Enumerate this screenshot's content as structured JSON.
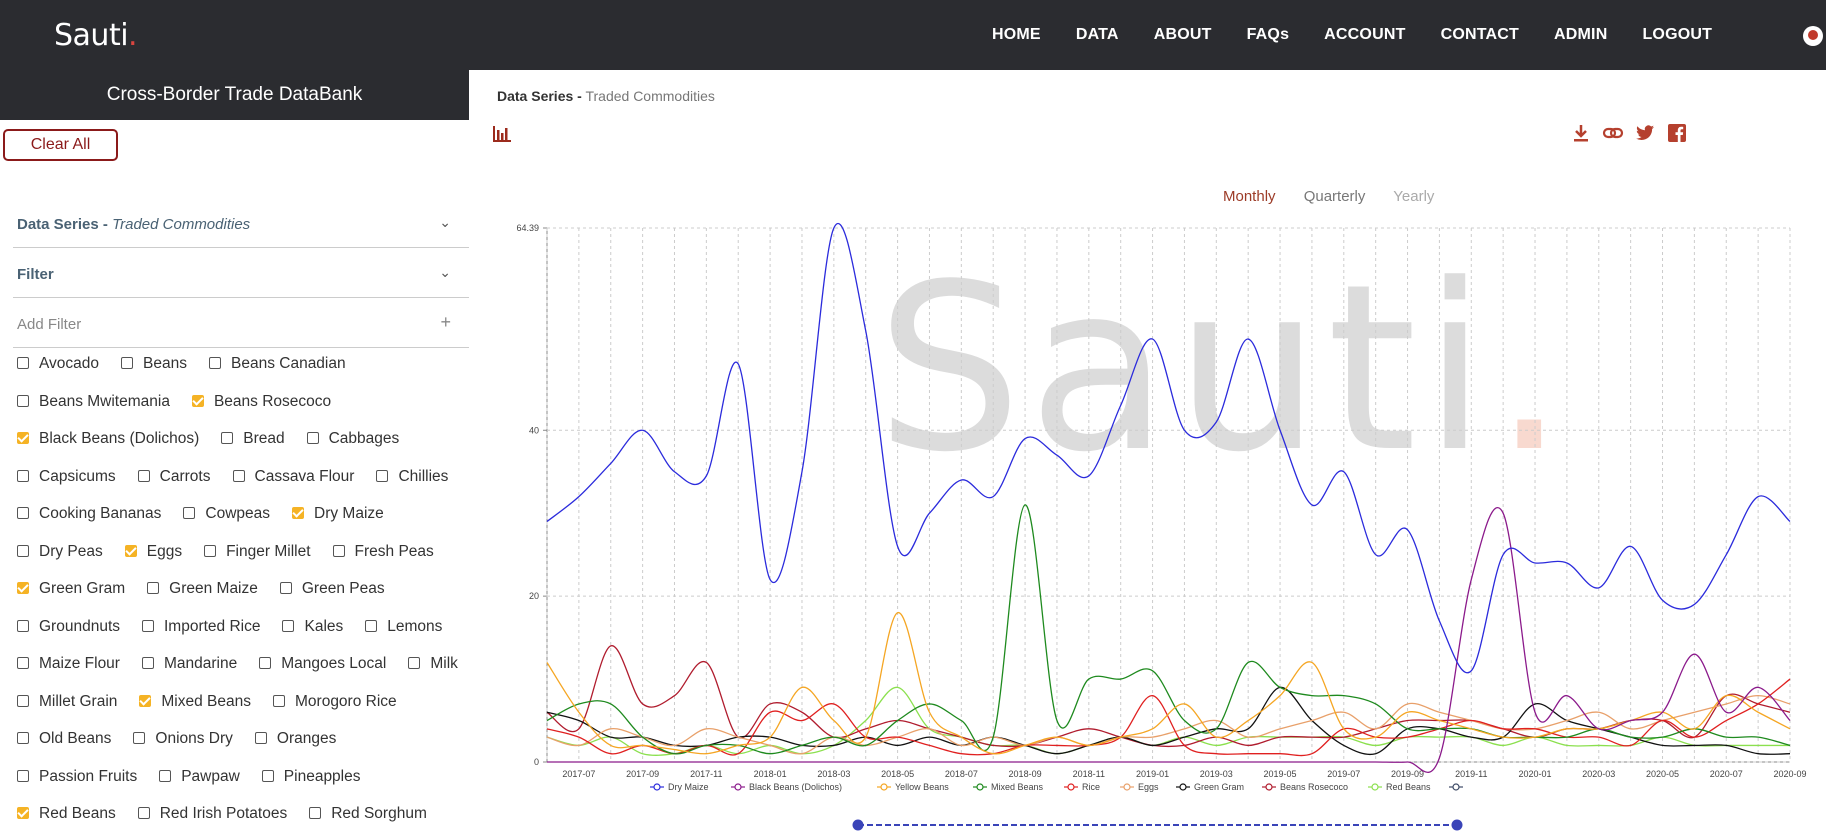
{
  "nav": {
    "logo": "Sauti",
    "logo_dot": ".",
    "links": [
      "HOME",
      "DATA",
      "ABOUT",
      "FAQs",
      "ACCOUNT",
      "CONTACT",
      "ADMIN",
      "LOGOUT"
    ]
  },
  "sidebar": {
    "title": "Cross-Border Trade DataBank",
    "clear_all": "Clear All",
    "data_series_label": "Data Series -",
    "data_series_value": "Traded Commodities",
    "filter_label": "Filter",
    "add_filter_label": "Add Filter",
    "rows": [
      [
        {
          "label": "Avocado",
          "checked": false
        },
        {
          "label": "Beans",
          "checked": false
        },
        {
          "label": "Beans Canadian",
          "checked": false
        }
      ],
      [
        {
          "label": "Beans Mwitemania",
          "checked": false
        },
        {
          "label": "Beans Rosecoco",
          "checked": true
        }
      ],
      [
        {
          "label": "Black Beans (Dolichos)",
          "checked": true
        },
        {
          "label": "Bread",
          "checked": false
        },
        {
          "label": "Cabbages",
          "checked": false
        }
      ],
      [
        {
          "label": "Capsicums",
          "checked": false
        },
        {
          "label": "Carrots",
          "checked": false
        },
        {
          "label": "Cassava Flour",
          "checked": false
        },
        {
          "label": "Chillies",
          "checked": false
        }
      ],
      [
        {
          "label": "Cooking Bananas",
          "checked": false
        },
        {
          "label": "Cowpeas",
          "checked": false
        },
        {
          "label": "Dry Maize",
          "checked": true
        }
      ],
      [
        {
          "label": "Dry Peas",
          "checked": false
        },
        {
          "label": "Eggs",
          "checked": true
        },
        {
          "label": "Finger Millet",
          "checked": false
        },
        {
          "label": "Fresh Peas",
          "checked": false
        }
      ],
      [
        {
          "label": "Green Gram",
          "checked": true
        },
        {
          "label": "Green Maize",
          "checked": false
        },
        {
          "label": "Green Peas",
          "checked": false
        }
      ],
      [
        {
          "label": "Groundnuts",
          "checked": false
        },
        {
          "label": "Imported Rice",
          "checked": false
        },
        {
          "label": "Kales",
          "checked": false
        },
        {
          "label": "Lemons",
          "checked": false
        }
      ],
      [
        {
          "label": "Maize Flour",
          "checked": false
        },
        {
          "label": "Mandarine",
          "checked": false
        },
        {
          "label": "Mangoes Local",
          "checked": false
        },
        {
          "label": "Milk",
          "checked": false
        }
      ],
      [
        {
          "label": "Millet Grain",
          "checked": false
        },
        {
          "label": "Mixed Beans",
          "checked": true
        },
        {
          "label": "Morogoro Rice",
          "checked": false
        }
      ],
      [
        {
          "label": "Old Beans",
          "checked": false
        },
        {
          "label": "Onions Dry",
          "checked": false
        },
        {
          "label": "Oranges",
          "checked": false
        }
      ],
      [
        {
          "label": "Passion Fruits",
          "checked": false
        },
        {
          "label": "Pawpaw",
          "checked": false
        },
        {
          "label": "Pineapples",
          "checked": false
        }
      ],
      [
        {
          "label": "Red Beans",
          "checked": true
        },
        {
          "label": "Red Irish Potatoes",
          "checked": false
        },
        {
          "label": "Red Sorghum",
          "checked": false
        }
      ]
    ]
  },
  "main": {
    "title_bold": "Data Series -",
    "title_sub": "Traded Commodities",
    "periods": [
      "Monthly",
      "Quarterly",
      "Yearly"
    ],
    "selected_period": "Monthly",
    "watermark": "Sauti",
    "watermark_dot": ".",
    "share_icons": [
      "download-icon",
      "link-icon",
      "twitter-icon",
      "facebook-icon"
    ]
  },
  "chart_data": {
    "type": "line",
    "x": [
      "2017-06",
      "2017-07",
      "2017-08",
      "2017-09",
      "2017-10",
      "2017-11",
      "2017-12",
      "2018-01",
      "2018-02",
      "2018-03",
      "2018-04",
      "2018-05",
      "2018-06",
      "2018-07",
      "2018-08",
      "2018-09",
      "2018-10",
      "2018-11",
      "2018-12",
      "2019-01",
      "2019-02",
      "2019-03",
      "2019-04",
      "2019-05",
      "2019-06",
      "2019-07",
      "2019-08",
      "2019-09",
      "2019-10",
      "2019-11",
      "2019-12",
      "2020-01",
      "2020-02",
      "2020-03",
      "2020-04",
      "2020-05",
      "2020-06",
      "2020-07",
      "2020-08",
      "2020-09"
    ],
    "x_ticks": [
      "2017-07",
      "2017-09",
      "2017-11",
      "2018-01",
      "2018-03",
      "2018-05",
      "2018-07",
      "2018-09",
      "2018-11",
      "2019-01",
      "2019-03",
      "2019-05",
      "2019-07",
      "2019-09",
      "2019-11",
      "2020-01",
      "2020-03",
      "2020-05",
      "2020-07",
      "2020-09"
    ],
    "y_ticks": [
      "0",
      "20",
      "40",
      "64.39"
    ],
    "ylim": [
      0,
      64.39
    ],
    "grid": true,
    "legend_position": "bottom",
    "series": [
      {
        "name": "Dry Maize",
        "color": "#2b2bdc",
        "values": [
          29,
          32,
          36,
          40,
          35,
          34.5,
          48,
          22,
          35,
          64.39,
          52,
          26,
          30,
          34,
          32,
          39,
          37,
          34.5,
          43,
          51,
          40,
          41,
          51,
          40,
          31,
          35,
          25,
          28,
          17,
          11,
          25,
          24,
          24,
          21,
          26,
          19.5,
          19,
          25,
          32,
          29
        ]
      },
      {
        "name": "Black Beans (Dolichos)",
        "color": "#8b1a8b",
        "values": [
          0,
          0,
          0,
          0,
          0,
          0,
          0,
          0,
          0,
          0,
          0,
          0,
          0,
          0,
          0,
          0,
          0,
          0,
          0,
          0,
          0,
          0,
          0,
          0,
          0,
          0,
          0,
          0,
          0.5,
          22,
          30,
          6,
          8,
          4,
          5,
          6,
          13,
          6,
          9,
          5
        ]
      },
      {
        "name": "Yellow Beans",
        "color": "#f5a623",
        "values": [
          12,
          6,
          2,
          2,
          1.5,
          1,
          2,
          3,
          9,
          5,
          3,
          18,
          6,
          3,
          1,
          2,
          3,
          2,
          3,
          4,
          7,
          3,
          5,
          8,
          12,
          4,
          3,
          6,
          5,
          4,
          3,
          3,
          4,
          4,
          5,
          6,
          4,
          8,
          6,
          4
        ]
      },
      {
        "name": "Mixed Beans",
        "color": "#1e8a1e",
        "values": [
          5,
          7,
          7,
          3,
          1,
          2,
          2,
          1,
          2,
          3,
          2,
          5,
          7,
          5,
          3,
          31,
          5,
          10,
          10,
          11,
          5,
          4,
          12,
          9,
          8,
          8,
          7,
          4,
          4,
          4,
          3,
          3,
          3,
          4,
          3,
          3,
          4,
          3,
          3,
          2
        ]
      },
      {
        "name": "Rice",
        "color": "#e02020",
        "values": [
          4,
          3,
          1,
          2,
          1,
          2,
          1,
          6,
          5,
          7,
          3,
          3,
          2,
          1,
          1,
          2,
          2,
          2,
          3,
          8,
          2,
          1,
          1,
          1,
          1,
          4,
          3,
          3,
          4,
          5,
          4,
          4,
          3,
          3,
          2,
          5,
          3,
          5,
          7,
          10
        ]
      },
      {
        "name": "Eggs",
        "color": "#e8a06a",
        "values": [
          3,
          2,
          4,
          3,
          2,
          4,
          3,
          2,
          1,
          3,
          2,
          3,
          4,
          2,
          3,
          2,
          3,
          2,
          3,
          3,
          4,
          5,
          3,
          4,
          5,
          6,
          4,
          7,
          6,
          5,
          4,
          4,
          5,
          6,
          4,
          5,
          6,
          7,
          8,
          7
        ]
      },
      {
        "name": "Green Gram",
        "color": "#111111",
        "values": [
          6,
          5,
          3,
          3,
          2,
          2,
          3,
          3,
          2,
          2,
          3,
          2,
          3,
          2,
          3,
          2,
          1,
          2,
          3,
          2,
          3,
          4,
          4,
          9,
          5,
          2,
          1,
          4,
          4,
          3,
          3,
          7,
          5,
          4,
          3,
          2,
          2,
          2,
          1,
          1
        ]
      },
      {
        "name": "Beans Rosecoco",
        "color": "#b01c2e",
        "values": [
          6,
          4,
          14,
          7,
          8,
          12,
          3,
          7,
          6,
          3,
          4,
          5,
          4,
          3,
          2,
          2,
          3,
          4,
          3,
          2,
          2,
          3,
          2,
          3,
          3,
          3,
          4,
          5,
          5,
          5,
          4,
          3,
          4,
          4,
          5,
          5,
          3,
          8,
          7,
          6
        ]
      },
      {
        "name": "Red Beans",
        "color": "#8be04e",
        "values": [
          3,
          2,
          3,
          1,
          1,
          2,
          1,
          2,
          1,
          2,
          5,
          9,
          4,
          3,
          2,
          2,
          1,
          2,
          3,
          2,
          3,
          2,
          3,
          3,
          3,
          3,
          2,
          3,
          3,
          3,
          2,
          3,
          2,
          2,
          2,
          3,
          2,
          2,
          2,
          2
        ]
      },
      {
        "name": "",
        "color": "#3d4a66",
        "values": []
      }
    ]
  }
}
